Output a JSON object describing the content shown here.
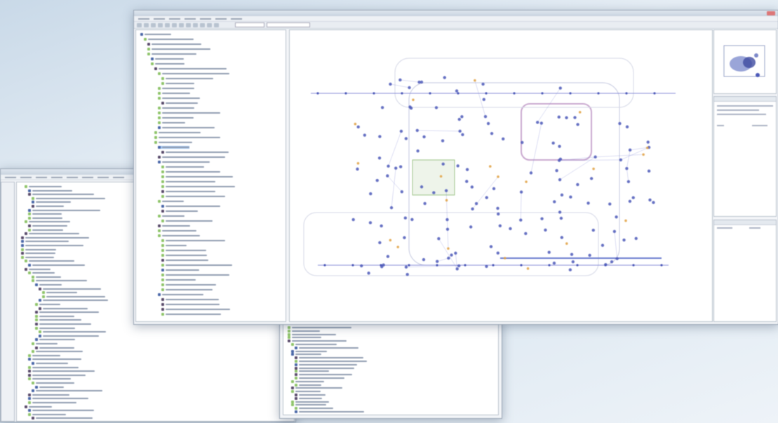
{
  "colors": {
    "tree_icon_green": "#8fc46a",
    "tree_icon_blue": "#4a67a8",
    "tree_icon_dark": "#5a4b6b",
    "selection": "#9fc3ee",
    "graph_edge": "#8a8fd8",
    "graph_node": "#4b58b8",
    "graph_accent": "#e0a040"
  },
  "icons": {
    "window_close": "close-icon",
    "folder": "folder-icon",
    "graph_node": "node-icon"
  },
  "main_window": {
    "tree_rows": 58,
    "selected_row_index": 23
  },
  "back_window": {
    "tree_rows": 60
  },
  "bottom_window": {
    "list_rows": 26
  }
}
